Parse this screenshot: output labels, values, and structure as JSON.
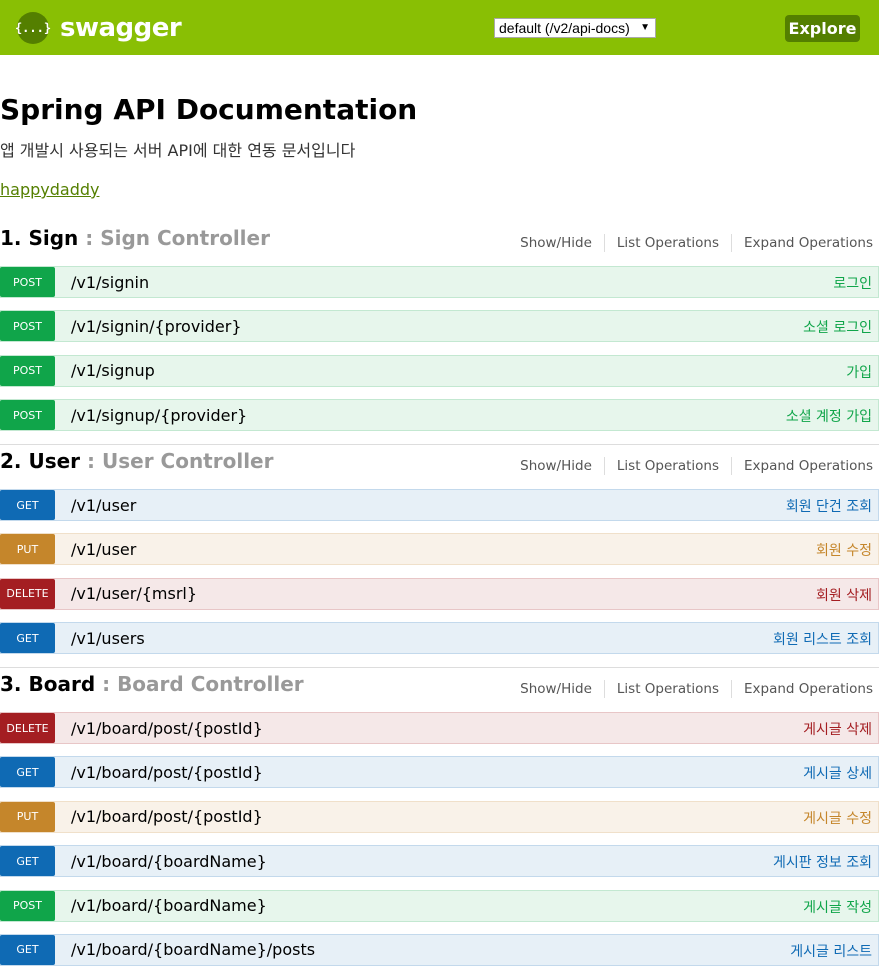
{
  "header": {
    "logo_icon": "{...}",
    "logo_text": "swagger",
    "api_select": "default (/v2/api-docs)",
    "explore_label": "Explore"
  },
  "info": {
    "title": "Spring API Documentation",
    "description": "앱 개발시 사용되는 서버 API에 대한 연동 문서입니다",
    "contact": "happydaddy"
  },
  "sections": [
    {
      "num": "1. Sign",
      "controller": " : Sign Controller",
      "show_hide": "Show/Hide",
      "list_ops": "List Operations",
      "expand_ops": "Expand Operations",
      "ops": [
        {
          "method": "POST",
          "path": "/v1/signin",
          "summary": "로그인"
        },
        {
          "method": "POST",
          "path": "/v1/signin/{provider}",
          "summary": "소셜 로그인"
        },
        {
          "method": "POST",
          "path": "/v1/signup",
          "summary": "가입"
        },
        {
          "method": "POST",
          "path": "/v1/signup/{provider}",
          "summary": "소셜 계정 가입"
        }
      ]
    },
    {
      "num": "2. User",
      "controller": " : User Controller",
      "show_hide": "Show/Hide",
      "list_ops": "List Operations",
      "expand_ops": "Expand Operations",
      "ops": [
        {
          "method": "GET",
          "path": "/v1/user",
          "summary": "회원 단건 조회"
        },
        {
          "method": "PUT",
          "path": "/v1/user",
          "summary": "회원 수정"
        },
        {
          "method": "DELETE",
          "path": "/v1/user/{msrl}",
          "summary": "회원 삭제"
        },
        {
          "method": "GET",
          "path": "/v1/users",
          "summary": "회원 리스트 조회"
        }
      ]
    },
    {
      "num": "3. Board",
      "controller": " : Board Controller",
      "show_hide": "Show/Hide",
      "list_ops": "List Operations",
      "expand_ops": "Expand Operations",
      "ops": [
        {
          "method": "DELETE",
          "path": "/v1/board/post/{postId}",
          "summary": "게시글 삭제"
        },
        {
          "method": "GET",
          "path": "/v1/board/post/{postId}",
          "summary": "게시글 상세"
        },
        {
          "method": "PUT",
          "path": "/v1/board/post/{postId}",
          "summary": "게시글 수정"
        },
        {
          "method": "GET",
          "path": "/v1/board/{boardName}",
          "summary": "게시판 정보 조회"
        },
        {
          "method": "POST",
          "path": "/v1/board/{boardName}",
          "summary": "게시글 작성"
        },
        {
          "method": "GET",
          "path": "/v1/board/{boardName}/posts",
          "summary": "게시글 리스트"
        }
      ]
    }
  ]
}
